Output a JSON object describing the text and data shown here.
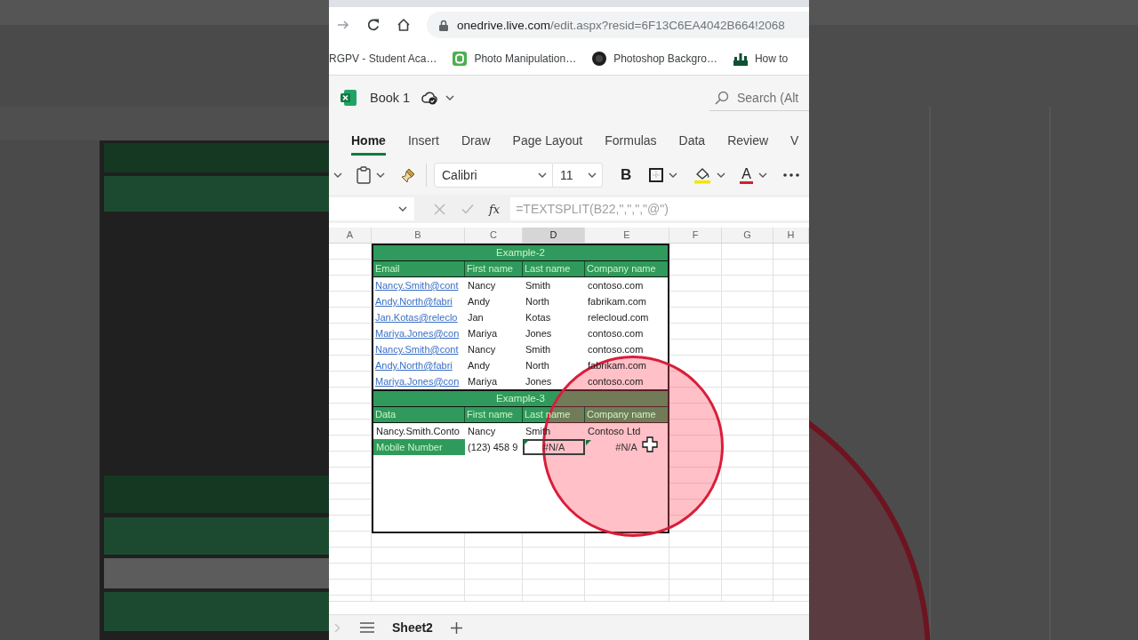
{
  "browser": {
    "url": "onedrive.live.com/edit.aspx?resid=6F13C6EA4042B664!2068",
    "bookmarks": [
      {
        "label": "RGPV - Student Aca…",
        "kind": "plain"
      },
      {
        "label": "Photo Manipulation…",
        "kind": "tile"
      },
      {
        "label": "Photoshop Backgro…",
        "kind": "disc"
      },
      {
        "label": "How to",
        "kind": "chart"
      }
    ]
  },
  "app": {
    "title": "Book 1",
    "search": {
      "placeholder": "Search (Alt"
    }
  },
  "ribbon_tabs": [
    {
      "label": "Home",
      "selected": true
    },
    {
      "label": "Insert",
      "selected": false
    },
    {
      "label": "Draw",
      "selected": false
    },
    {
      "label": "Page Layout",
      "selected": false
    },
    {
      "label": "Formulas",
      "selected": false
    },
    {
      "label": "Data",
      "selected": false
    },
    {
      "label": "Review",
      "selected": false
    },
    {
      "label": "V",
      "selected": false
    }
  ],
  "toolbar": {
    "font": "Calibri",
    "size": "11",
    "bold_label": "B",
    "font_color_label": "A"
  },
  "formula_bar": {
    "function_label": "fx",
    "formula": "=TEXTSPLIT(B22,\",\",\",\"@\")"
  },
  "sheet": {
    "columns": [
      {
        "label": "A",
        "selected": false
      },
      {
        "label": "B",
        "selected": false
      },
      {
        "label": "C",
        "selected": false
      },
      {
        "label": "D",
        "selected": true
      },
      {
        "label": "E",
        "selected": false
      },
      {
        "label": "F",
        "selected": false
      },
      {
        "label": "G",
        "selected": false
      },
      {
        "label": "H",
        "selected": false
      }
    ],
    "tables": [
      {
        "title": "Example-2",
        "header": [
          "Email",
          "First name",
          "Last name",
          "Company name"
        ],
        "rows": [
          [
            {
              "text": "Nancy.Smith@cont",
              "kind": "link",
              "selected": false
            },
            {
              "text": "Nancy",
              "kind": "text",
              "selected": false
            },
            {
              "text": "Smith",
              "kind": "text",
              "selected": false
            },
            {
              "text": "contoso.com",
              "kind": "text",
              "selected": false
            }
          ],
          [
            {
              "text": "Andy.North@fabri",
              "kind": "link",
              "selected": false
            },
            {
              "text": "Andy",
              "kind": "text",
              "selected": false
            },
            {
              "text": "North",
              "kind": "text",
              "selected": false
            },
            {
              "text": "fabrikam.com",
              "kind": "text",
              "selected": false
            }
          ],
          [
            {
              "text": "Jan.Kotas@releclo",
              "kind": "link",
              "selected": false
            },
            {
              "text": "Jan",
              "kind": "text",
              "selected": false
            },
            {
              "text": "Kotas",
              "kind": "text",
              "selected": false
            },
            {
              "text": "relecloud.com",
              "kind": "text",
              "selected": false
            }
          ],
          [
            {
              "text": "Mariya.Jones@con",
              "kind": "link",
              "selected": false
            },
            {
              "text": "Mariya",
              "kind": "text",
              "selected": false
            },
            {
              "text": "Jones",
              "kind": "text",
              "selected": false
            },
            {
              "text": "contoso.com",
              "kind": "text",
              "selected": false
            }
          ],
          [
            {
              "text": "Nancy.Smith@cont",
              "kind": "link",
              "selected": false
            },
            {
              "text": "Nancy",
              "kind": "text",
              "selected": false
            },
            {
              "text": "Smith",
              "kind": "text",
              "selected": false
            },
            {
              "text": "contoso.com",
              "kind": "text",
              "selected": false
            }
          ],
          [
            {
              "text": "Andy.North@fabri",
              "kind": "link",
              "selected": false
            },
            {
              "text": "Andy",
              "kind": "text",
              "selected": false
            },
            {
              "text": "North",
              "kind": "text",
              "selected": false
            },
            {
              "text": "fabrikam.com",
              "kind": "text",
              "selected": false
            }
          ],
          [
            {
              "text": "Mariya.Jones@con",
              "kind": "link",
              "selected": false
            },
            {
              "text": "Mariya",
              "kind": "text",
              "selected": false
            },
            {
              "text": "Jones",
              "kind": "text",
              "selected": false
            },
            {
              "text": "contoso.com",
              "kind": "text",
              "selected": false
            }
          ]
        ]
      },
      {
        "title": "Example-3",
        "header": [
          "Data",
          "First name",
          "Last name",
          "Company name"
        ],
        "rows": [
          [
            {
              "text": "Nancy.Smith.Conto",
              "kind": "text",
              "selected": false
            },
            {
              "text": "Nancy",
              "kind": "text",
              "selected": false
            },
            {
              "text": "Smith",
              "kind": "text",
              "selected": false
            },
            {
              "text": "Contoso Ltd",
              "kind": "text",
              "selected": false
            }
          ],
          [
            {
              "text": "Mobile Number",
              "kind": "label",
              "selected": false
            },
            {
              "text": "(123) 458 9",
              "kind": "text",
              "selected": false
            },
            {
              "text": "#N/A",
              "kind": "error",
              "selected": true
            },
            {
              "text": "#N/A",
              "kind": "error",
              "selected": false
            }
          ]
        ]
      }
    ]
  },
  "sheet_tabs": [
    {
      "label": "Sheet2",
      "selected": true
    }
  ]
}
